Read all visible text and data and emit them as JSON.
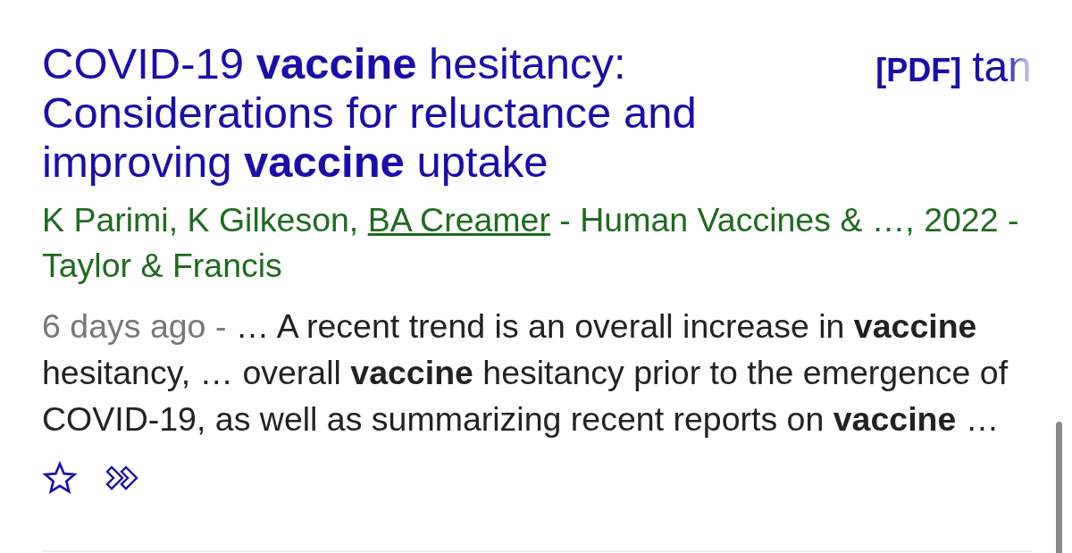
{
  "result": {
    "title": "COVID-19 **vaccine** hesitancy: Considerations for reluctance and improving **vaccine** uptake",
    "pdf_tag": "[PDF]",
    "pdf_source": "tan",
    "authors": [
      {
        "kind": "text",
        "text": "K Parimi, K Gilkeson, "
      },
      {
        "kind": "link",
        "text": "BA Creamer"
      },
      {
        "kind": "text",
        "text": " - Human Vaccines & …, 2022 - Taylor & Francis"
      }
    ],
    "date": "6 days ago -",
    "snippet": "… A recent trend is an overall increase in **vaccine** hesitancy, … overall **vaccine** hesitancy prior to the emergence of COVID-19, as well as summarizing recent reports on **vaccine** …"
  }
}
